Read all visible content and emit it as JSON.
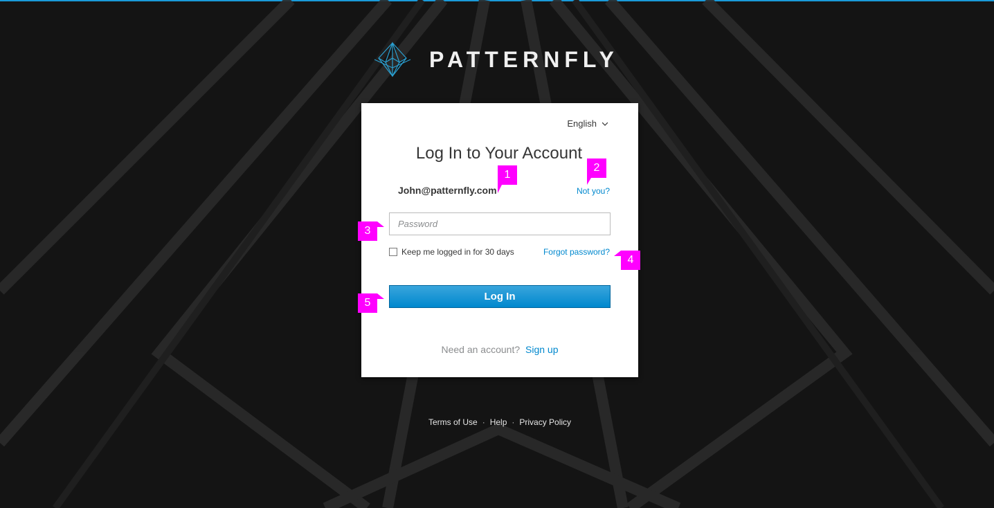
{
  "brand": {
    "name": "PATTERNFLY",
    "logo_icon": "patternfly-logo-icon"
  },
  "card": {
    "language": "English",
    "title": "Log In to Your Account",
    "email": "John@patternfly.com",
    "not_you_link": "Not you?",
    "password_placeholder": "Password",
    "keep_logged_in_label": "Keep me logged in for 30 days",
    "forgot_password_link": "Forgot password?",
    "login_button": "Log In",
    "need_account_text": "Need an account?",
    "sign_up_link": "Sign up"
  },
  "footer": {
    "links": [
      "Terms of Use",
      "Help",
      "Privacy Policy"
    ],
    "separator": "·"
  },
  "annotations": [
    "1",
    "2",
    "3",
    "4",
    "5"
  ],
  "colors": {
    "accent": "#0088ce",
    "callout": "#ff00ff",
    "background": "#141414",
    "top_line": "#1a9ad9"
  }
}
